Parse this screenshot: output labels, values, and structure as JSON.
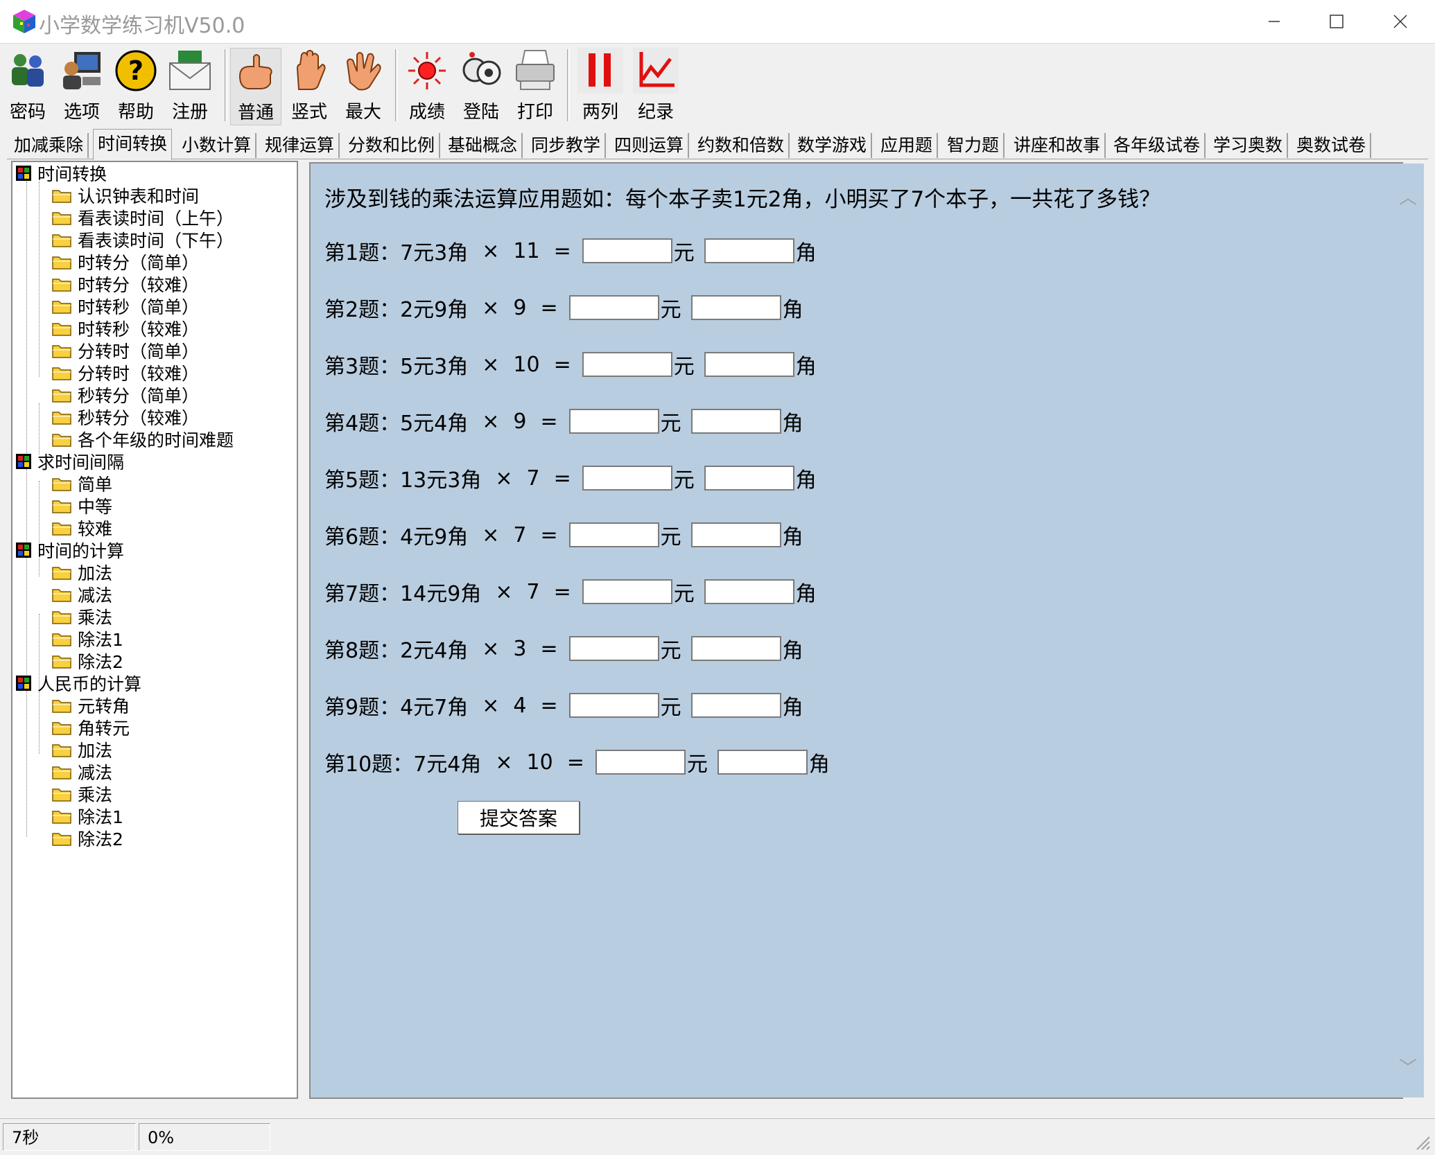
{
  "window": {
    "title": "小学数学练习机V50.0"
  },
  "toolbar": {
    "buttons": [
      {
        "label": "密码",
        "icon": "users-icon"
      },
      {
        "label": "选项",
        "icon": "options-icon"
      },
      {
        "label": "帮助",
        "icon": "help-icon"
      },
      {
        "label": "注册",
        "icon": "mail-icon"
      },
      {
        "label": "普通",
        "icon": "hand-point-icon"
      },
      {
        "label": "竖式",
        "icon": "hand-open-icon"
      },
      {
        "label": "最大",
        "icon": "hand-wave-icon"
      },
      {
        "label": "成绩",
        "icon": "red-light-icon"
      },
      {
        "label": "登陆",
        "icon": "login-icon"
      },
      {
        "label": "打印",
        "icon": "printer-icon"
      },
      {
        "label": "两列",
        "icon": "two-columns-icon"
      },
      {
        "label": "纪录",
        "icon": "chart-icon"
      }
    ]
  },
  "tabs": [
    "加减乘除",
    "时间转换",
    "小数计算",
    "规律运算",
    "分数和比例",
    "基础概念",
    "同步教学",
    "四则运算",
    "约数和倍数",
    "数学游戏",
    "应用题",
    "智力题",
    "讲座和故事",
    "各年级试卷",
    "学习奥数",
    "奥数试卷"
  ],
  "active_tab": "时间转换",
  "tree": {
    "categories": [
      {
        "label": "时间转换",
        "items": [
          "认识钟表和时间",
          "看表读时间（上午）",
          "看表读时间（下午）",
          "时转分（简单）",
          "时转分（较难）",
          "时转秒（简单）",
          "时转秒（较难）",
          "分转时（简单）",
          "分转时（较难）",
          "秒转分（简单）",
          "秒转分（较难）",
          "各个年级的时间难题"
        ]
      },
      {
        "label": "求时间间隔",
        "items": [
          "简单",
          "中等",
          "较难"
        ]
      },
      {
        "label": "时间的计算",
        "items": [
          "加法",
          "减法",
          "乘法",
          "除法1",
          "除法2"
        ]
      },
      {
        "label": "人民币的计算",
        "items": [
          "元转角",
          "角转元",
          "加法",
          "减法",
          "乘法",
          "除法1",
          "除法2"
        ]
      }
    ]
  },
  "content": {
    "instruction": "涉及到钱的乘法运算应用题如：每个本子卖1元2角，小明买了7个本子，一共花了多钱？",
    "questions": [
      {
        "label": "第1题：",
        "amount": "7元3角",
        "op": "×",
        "factor": "11",
        "eq": "="
      },
      {
        "label": "第2题：",
        "amount": "2元9角",
        "op": "×",
        "factor": "9",
        "eq": "="
      },
      {
        "label": "第3题：",
        "amount": "5元3角",
        "op": "×",
        "factor": "10",
        "eq": "="
      },
      {
        "label": "第4题：",
        "amount": "5元4角",
        "op": "×",
        "factor": "9",
        "eq": "="
      },
      {
        "label": "第5题：",
        "amount": "13元3角",
        "op": "×",
        "factor": "7",
        "eq": "="
      },
      {
        "label": "第6题：",
        "amount": "4元9角",
        "op": "×",
        "factor": "7",
        "eq": "="
      },
      {
        "label": "第7题：",
        "amount": "14元9角",
        "op": "×",
        "factor": "7",
        "eq": "="
      },
      {
        "label": "第8题：",
        "amount": "2元4角",
        "op": "×",
        "factor": "3",
        "eq": "="
      },
      {
        "label": "第9题：",
        "amount": "4元7角",
        "op": "×",
        "factor": "4",
        "eq": "="
      },
      {
        "label": "第10题：",
        "amount": "7元4角",
        "op": "×",
        "factor": "10",
        "eq": "="
      }
    ],
    "unit_yuan": "元",
    "unit_jiao": "角",
    "submit_label": "提交答案"
  },
  "status": {
    "time": "7秒",
    "progress": "0%"
  },
  "colors": {
    "content_bg": "#b9cde0",
    "window_bg": "#f0f0f0"
  }
}
